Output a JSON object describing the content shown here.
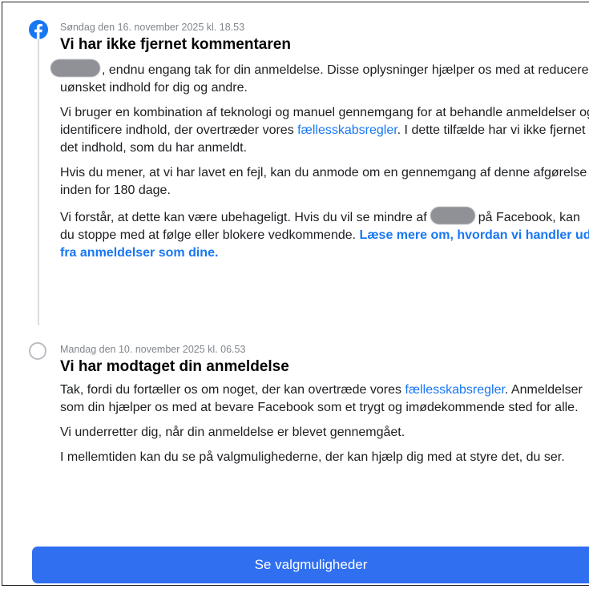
{
  "report_history": {
    "decision": {
      "timestamp": "Søndag den 16. november 2025 kl. 18.53",
      "title": "Vi har ikke fjernet kommentaren",
      "p1_text": ", endnu engang tak for din anmeldelse. Disse oplysninger hjælper os med at reducere uønsket indhold for dig og andre.",
      "p2_before": "Vi bruger en kombination af teknologi og manuel gennemgang for at behandle anmeldelser og identificere indhold, der overtræder vores ",
      "p2_link": "fællesskabsregler",
      "p2_after": ". I dette tilfælde har vi ikke fjernet det indhold, som du har anmeldt.",
      "p3_text": "Hvis du mener, at vi har lavet en fejl, kan du anmode om en gennemgang af denne afgørelse inden for 180 dage.",
      "p4_before": "Vi forstår, at dette kan være ubehageligt. Hvis du vil se mindre af",
      "p4_middle": "på Facebook, kan du stoppe med at følge eller blokere vedkommende.",
      "p4_link": "Læse mere om, hvordan vi handler ud fra anmeldelser som dine."
    },
    "received": {
      "timestamp": "Mandag den 10. november 2025 kl. 06.53",
      "title": "Vi har modtaget din anmeldelse",
      "p1_before": "Tak, fordi du fortæller os om noget, der kan overtræde vores ",
      "p1_link": "fællesskabsregler",
      "p1_after": ". Anmeldelser som din hjælper os med at bevare Facebook som et trygt og imødekommende sted for alle.",
      "p2_text": "Vi underretter dig, når din anmeldelse er blevet gennemgået.",
      "p3_text": "I mellemtiden kan du se på valgmulighederne, der kan hjælp dig med at styre det, du ser."
    }
  },
  "cta": {
    "label": "Se valgmuligheder"
  },
  "colors": {
    "accent": "#1877f2",
    "button": "#2f6ff0",
    "muted": "#80858c"
  },
  "icons": {
    "decision": "facebook-icon",
    "received": "pending-circle-icon"
  }
}
